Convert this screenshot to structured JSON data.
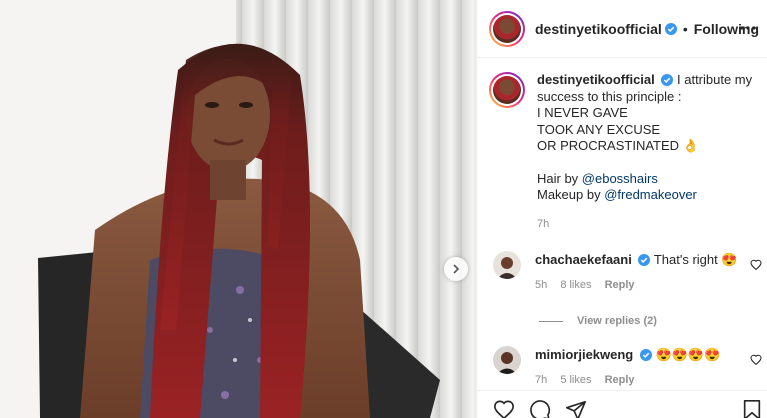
{
  "post": {
    "username": "destinyetikoofficial",
    "follow_status": "Following",
    "separator": "•"
  },
  "caption": {
    "username": "destinyetikoofficial",
    "line1": "I attribute my success to this principle :",
    "line2": "I NEVER GAVE",
    "line3": "TOOK ANY EXCUSE",
    "line4": "OR PROCRASTINATED 👌",
    "hair_prefix": "Hair by ",
    "hair_mention": "@ebosshairs",
    "makeup_prefix": "Makeup by ",
    "makeup_mention": "@fredmakeover",
    "time": "7h"
  },
  "comments": [
    {
      "username": "chachaekefaani",
      "text": "That's right 😍",
      "time": "5h",
      "likes": "8 likes",
      "reply_label": "Reply"
    },
    {
      "username": "mimiorjiekweng",
      "text": "😍😍😍😍",
      "time": "7h",
      "likes": "5 likes",
      "reply_label": "Reply"
    }
  ],
  "view_replies": "View replies (2)",
  "colors": {
    "verified": "#3897f0",
    "secondary_text": "#8e8e8e",
    "mention": "#00376b",
    "border": "#efefef"
  }
}
